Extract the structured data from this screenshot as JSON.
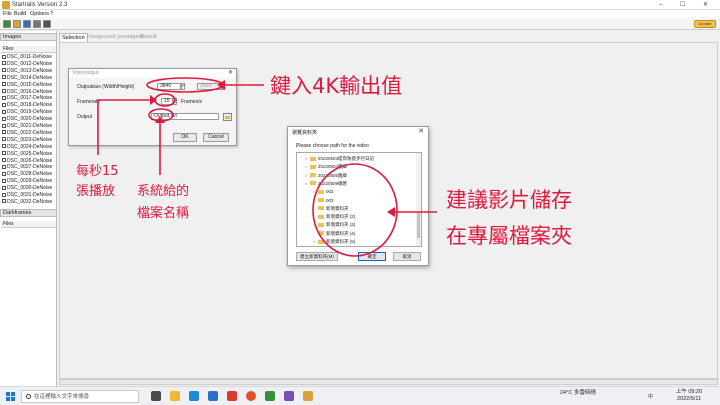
{
  "window": {
    "title": "Startrails Version 2.3"
  },
  "menu": [
    "File",
    "Build",
    "Options",
    "?"
  ],
  "toolbar": {
    "donate_label": "Donate"
  },
  "images_panel": {
    "header": "Images",
    "column": "Files",
    "files": [
      "DSC_0011-DeNoise",
      "DSC_0012-DeNoise",
      "DSC_0013-DeNoise",
      "DSC_0014-DeNoise",
      "DSC_0015-DeNoise",
      "DSC_0016-DeNoise",
      "DSC_0017-DeNoise",
      "DSC_0018-DeNoise",
      "DSC_0019-DeNoise",
      "DSC_0020-DeNoise",
      "DSC_0021-DeNoise",
      "DSC_0022-DeNoise",
      "DSC_0023-DeNoise",
      "DSC_0024-DeNoise",
      "DSC_0025-DeNoise",
      "DSC_0026-DeNoise",
      "DSC_0027-DeNoise",
      "DSC_0028-DeNoise",
      "DSC_0029-DeNoise",
      "DSC_0030-DeNoise",
      "DSC_0031-DeNoise",
      "DSC_0032-DeNoise"
    ]
  },
  "darkframes_panel": {
    "header": "Darkframes",
    "column": "Files"
  },
  "tabs": [
    "Selection",
    "Foreground (averaged)",
    "Result"
  ],
  "video_dialog": {
    "title": "Videooutput",
    "outputsize_label": "Outputsize (Width/Height)",
    "width": "3840",
    "height": "2560",
    "framerate_label": "Framerate",
    "framerate": "15",
    "framerate_unit": "Frames/s",
    "output_label": "Output",
    "output_value": "Output.avi",
    "ok_label": "OK",
    "cancel_label": "Cancel"
  },
  "browse_dialog": {
    "title": "瀏覽資料夾",
    "prompt": "Please choose path for the video",
    "tree": [
      {
        "label": "20220503堤岸防疫步行日記",
        "expand": ">",
        "indent": 0
      },
      {
        "label": "20220504圖庫",
        "expand": ">",
        "indent": 0
      },
      {
        "label": "20220505圖庫",
        "expand": ">",
        "indent": 0
      },
      {
        "label": "20220509總匯",
        "expand": "v",
        "indent": 0
      },
      {
        "label": "002",
        "expand": ">",
        "indent": 1
      },
      {
        "label": "003",
        "expand": "",
        "indent": 1
      },
      {
        "label": "新增資料夾",
        "expand": "",
        "indent": 1
      },
      {
        "label": "新增資料夾 (2)",
        "expand": "",
        "indent": 1
      },
      {
        "label": "新增資料夾 (3)",
        "expand": ">",
        "indent": 1
      },
      {
        "label": "新增資料夾 (4)",
        "expand": "",
        "indent": 1
      },
      {
        "label": "新增資料夾 (5)",
        "expand": ">",
        "indent": 1
      }
    ],
    "new_folder_label": "建立新資料夾(M)",
    "ok_label": "確定",
    "cancel_label": "取消"
  },
  "annotations": {
    "enter_4k": "鍵入4K輸出值",
    "fps_line1": "每秒15",
    "fps_line2": "張播放",
    "name_line1": "系統給的",
    "name_line2": "檔案名稱",
    "folder_line1": "建議影片儲存",
    "folder_line2": "在專屬檔案夾",
    "color": "#e0193e"
  },
  "taskbar": {
    "search_placeholder": "在這裡輸入文字來搜尋",
    "weather": "24°C",
    "weather_desc": "多雲時晴",
    "ime": "中",
    "time": "上午 09:20",
    "date": "2022/5/11"
  }
}
